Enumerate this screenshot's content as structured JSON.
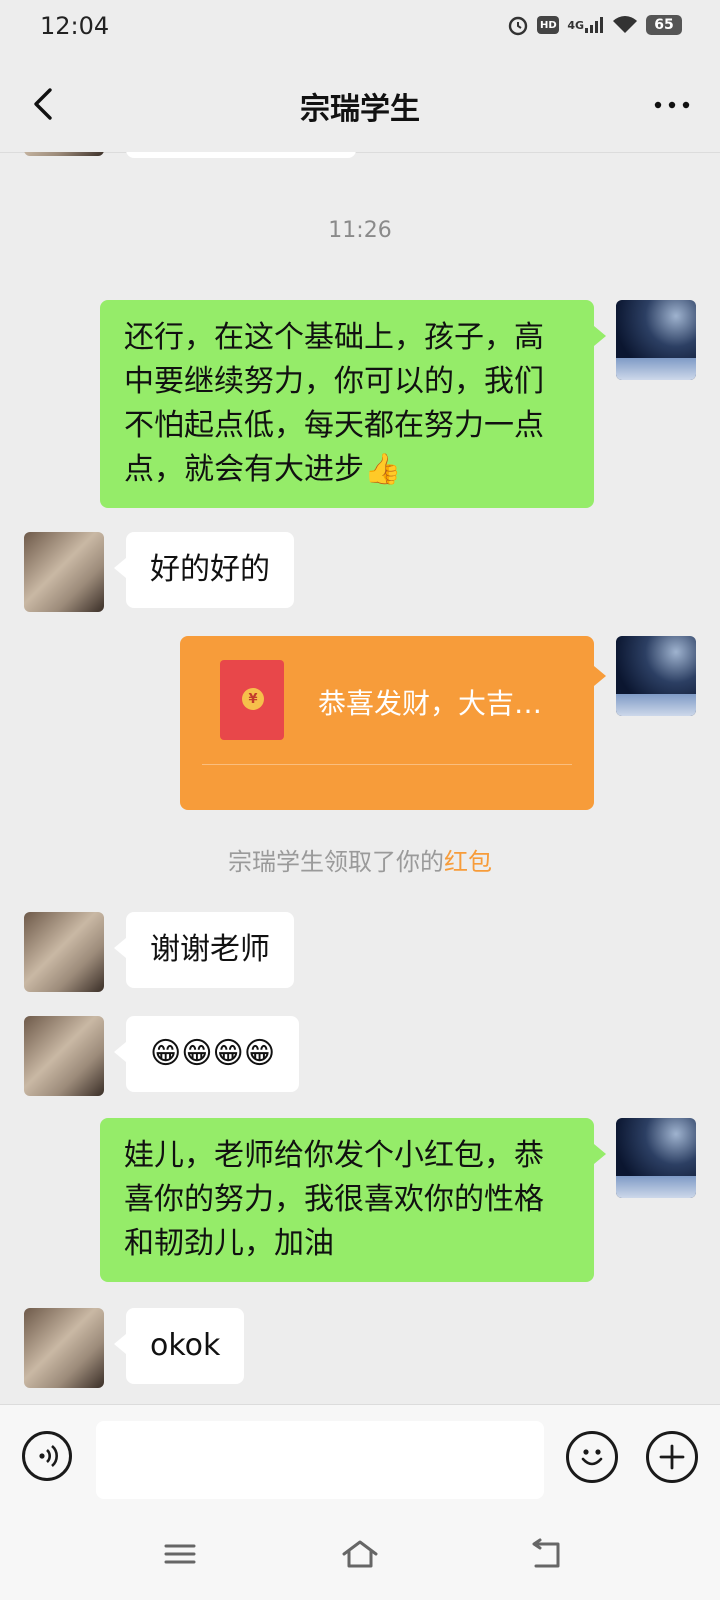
{
  "status_bar": {
    "time": "12:04",
    "network": "4G",
    "hd": "HD",
    "battery": "65"
  },
  "header": {
    "title": "宗瑞学生"
  },
  "chat": {
    "timestamp": "11:26",
    "messages": [
      {
        "side": "right",
        "type": "text",
        "text": "还行，在这个基础上，孩子，高中要继续努力，你可以的，我们不怕起点低，每天都在努力一点点，就会有大进步👍"
      },
      {
        "side": "left",
        "type": "text",
        "text": "好的好的"
      },
      {
        "side": "right",
        "type": "red_packet",
        "title": "恭喜发财，大吉…"
      },
      {
        "side": "system",
        "type": "note",
        "text": "宗瑞学生领取了你的",
        "highlight": "红包"
      },
      {
        "side": "left",
        "type": "text",
        "text": "谢谢老师"
      },
      {
        "side": "left",
        "type": "text",
        "text": "😁😁😁😁"
      },
      {
        "side": "right",
        "type": "text",
        "text": "娃儿，老师给你发个小红包，恭喜你的努力，我很喜欢你的性格和韧劲儿，加油"
      },
      {
        "side": "left",
        "type": "text",
        "text": "okok"
      }
    ]
  },
  "input_bar": {
    "placeholder": "",
    "value": ""
  },
  "colors": {
    "background": "#ededed",
    "self_bubble": "#95ec69",
    "other_bubble": "#ffffff",
    "red_packet": "#f79c3a",
    "envelope": "#e8474a"
  },
  "icons": {
    "back": "chevron-left-icon",
    "more": "more-dots-icon",
    "voice": "voice-icon",
    "emoji": "emoji-icon",
    "plus": "plus-icon",
    "menu": "menu-icon",
    "home": "home-icon",
    "back_nav": "back-nav-icon"
  }
}
